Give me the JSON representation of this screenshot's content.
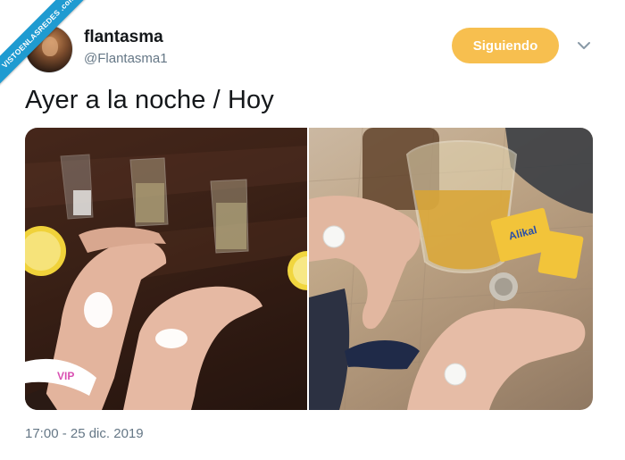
{
  "watermark": {
    "text": "VISTOENLASREDES .com"
  },
  "tweet": {
    "display_name": "flantasma",
    "handle": "@Flantasma1",
    "follow_button_label": "Siguiendo",
    "text": "Ayer a la noche / Hoy",
    "timestamp": "17:00 - 25 dic. 2019"
  },
  "media": {
    "left_wristband_text": "VIP",
    "right_packet_text": "Alikal"
  },
  "colors": {
    "follow_button": "#f7bf4f",
    "handle_gray": "#657786",
    "text_dark": "#14171a",
    "watermark_blue": "#1f9bd1"
  }
}
